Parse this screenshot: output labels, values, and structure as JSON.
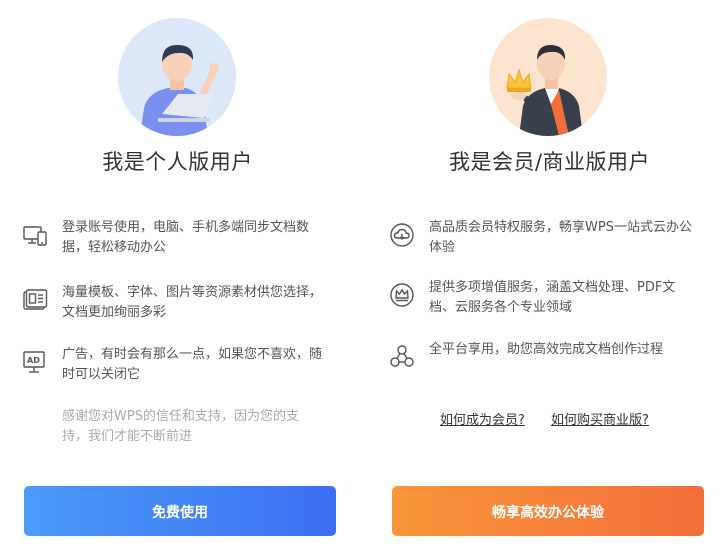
{
  "personal": {
    "avatar_icon": "personal-user-laptop-icon",
    "heading": "我是个人版用户",
    "features": [
      {
        "icon": "devices-sync-icon",
        "text": "登录账号使用，电脑、手机多端同步文档数据，轻松移动办公"
      },
      {
        "icon": "templates-icon",
        "text": "海量模板、字体、图片等资源素材供您选择，文档更加绚丽多彩"
      },
      {
        "icon": "ad-icon",
        "text": "广告，有时会有那么一点，如果您不喜欢，随时可以关闭它"
      }
    ],
    "thanks": "感谢您对WPS的信任和支持，因为您的支持，我们才能不断前进",
    "button_label": "免费使用"
  },
  "member": {
    "avatar_icon": "business-user-crown-icon",
    "heading": "我是会员/商业版用户",
    "features": [
      {
        "icon": "cloud-service-icon",
        "text": "高品质会员特权服务，畅享WPS一站式云办公体验"
      },
      {
        "icon": "crown-badge-icon",
        "text": "提供多项增值服务，涵盖文档处理、PDF文档、云服务各个专业领域"
      },
      {
        "icon": "platform-share-icon",
        "text": "全平台享用，助您高效完成文档创作过程"
      }
    ],
    "links": {
      "become_member": "如何成为会员?",
      "buy_business": "如何购买商业版?"
    },
    "button_label": "畅享高效办公体验"
  },
  "colors": {
    "personal_button_start": "#4a9bf8",
    "personal_button_end": "#3c6ef2",
    "member_button_start": "#f8953a",
    "member_button_end": "#f36f3a"
  }
}
